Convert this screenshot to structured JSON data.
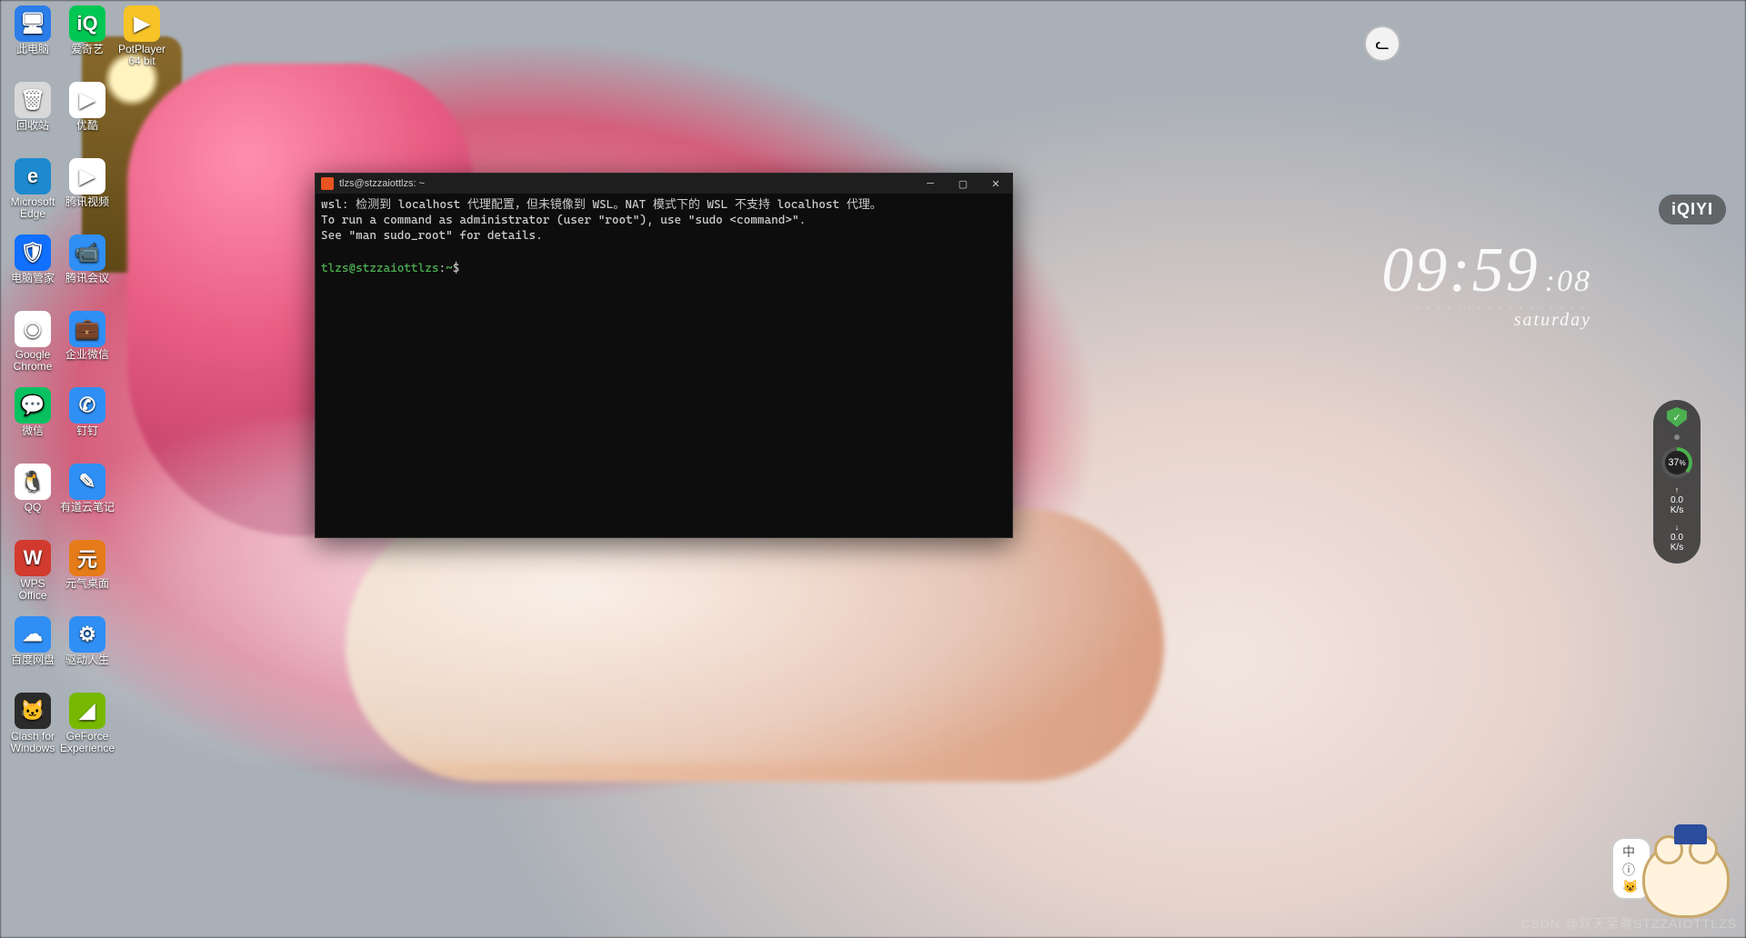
{
  "desktop_icons": {
    "col": [
      {
        "label": "此电脑",
        "bg": "#2b7de9",
        "glyph": "🖥"
      },
      {
        "label": "回收站",
        "bg": "#d8d8d8",
        "glyph": "🗑"
      },
      {
        "label": "Microsoft Edge",
        "bg": "#1d8ad0",
        "glyph": "e"
      },
      {
        "label": "电脑管家",
        "bg": "#1070ff",
        "glyph": "🛡"
      },
      {
        "label": "Google Chrome",
        "bg": "#ffffff",
        "glyph": "◉"
      },
      {
        "label": "微信",
        "bg": "#07c160",
        "glyph": "💬"
      },
      {
        "label": "QQ",
        "bg": "#ffffff",
        "glyph": "🐧"
      },
      {
        "label": "WPS Office",
        "bg": "#d23a2e",
        "glyph": "W"
      },
      {
        "label": "百度网盘",
        "bg": "#2f8ff5",
        "glyph": "☁"
      },
      {
        "label": "Clash for Windows",
        "bg": "#2b2b2b",
        "glyph": "🐱"
      },
      {
        "label": "爱奇艺",
        "bg": "#00c853",
        "glyph": "iQ"
      },
      {
        "label": "优酷",
        "bg": "#ffffff",
        "glyph": "▶"
      },
      {
        "label": "腾讯视频",
        "bg": "#ffffff",
        "glyph": "▶"
      },
      {
        "label": "腾讯会议",
        "bg": "#2f8ff5",
        "glyph": "📹"
      },
      {
        "label": "企业微信",
        "bg": "#2f8ff5",
        "glyph": "💼"
      },
      {
        "label": "钉钉",
        "bg": "#2f8ff5",
        "glyph": "✆"
      },
      {
        "label": "有道云笔记",
        "bg": "#2f8ff5",
        "glyph": "✎"
      },
      {
        "label": "元气桌面",
        "bg": "#e67b19",
        "glyph": "元"
      },
      {
        "label": "驱动人生",
        "bg": "#2f8ff5",
        "glyph": "⚙"
      },
      {
        "label": "GeForce Experience",
        "bg": "#76b900",
        "glyph": "◢"
      }
    ],
    "top_extra": {
      "label": "PotPlayer 64 bit",
      "bg": "#f7c427",
      "glyph": "▶"
    }
  },
  "terminal": {
    "title": "tlzs@stzzaiottlzs: ~",
    "lines": [
      "wsl: 检测到 localhost 代理配置，但未镜像到 WSL。NAT 模式下的 WSL 不支持 localhost 代理。",
      "To run a command as administrator (user \"root\"), use \"sudo <command>\".",
      "See \"man sudo_root\" for details.",
      ""
    ],
    "prompt": {
      "user": "tlzs@stzzaiottlzs",
      "sep": ":",
      "path": "~",
      "sym": "$"
    }
  },
  "clock": {
    "hh": "09",
    "mm": "59",
    "ss": "08",
    "day": "saturday",
    "dots": "·················"
  },
  "iqiyi": {
    "label": "iQIYI"
  },
  "sysmon": {
    "shield": "✓",
    "cpu_pct": "37",
    "cpu_unit": "%",
    "up": "0.0",
    "up_unit": "K/s",
    "down": "0.0",
    "down_unit": "K/s"
  },
  "mascot": {
    "bubble": "中 ⓘ 😺"
  },
  "headwidget": {
    "glyph": "ᓚ"
  },
  "watermark": "CSDN @双天至尊STZZAIOTTLZS"
}
